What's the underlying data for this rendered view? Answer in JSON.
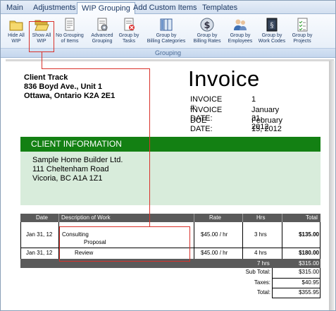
{
  "tabs": [
    {
      "label": "Main",
      "active": false
    },
    {
      "label": "Adjustments",
      "active": false
    },
    {
      "label": "WIP Grouping",
      "active": true
    },
    {
      "label": "Add Custom Items",
      "active": false
    },
    {
      "label": "Templates",
      "active": false
    }
  ],
  "ribbon": {
    "group_label": "Grouping",
    "buttons": [
      {
        "label": "Hide All\nWIP",
        "icon": "folder-icon"
      },
      {
        "label": "Show All\nWIP",
        "icon": "folder-open-icon"
      },
      {
        "label": "No Grouping\nof Items",
        "icon": "document-icon"
      },
      {
        "label": "Advanced\nGrouping",
        "icon": "document-gear-icon"
      },
      {
        "label": "Group by\nTasks",
        "icon": "document-cancel-icon"
      },
      {
        "label": "Group by\nBilling Categories",
        "icon": "columns-icon"
      },
      {
        "label": "Group by\nBilling Rates",
        "icon": "dollar-icon"
      },
      {
        "label": "Group by\nEmployees",
        "icon": "people-icon"
      },
      {
        "label": "Group by\nWork Codes",
        "icon": "book-icon"
      },
      {
        "label": "Group by\nProjects",
        "icon": "checklist-icon"
      }
    ]
  },
  "company": {
    "name": "Client Track",
    "address1": "836 Boyd Ave., Unit 1",
    "address2": "Ottawa, Ontario  K2A 2E1"
  },
  "invoice": {
    "title": "Invoice",
    "number_label": "INVOICE #:",
    "number": "1",
    "date_label": "INVOICE DATE:",
    "date": "January 31, 2012",
    "due_label": "DUE DATE:",
    "due": "February 15, 2012"
  },
  "client": {
    "heading": "CLIENT INFORMATION",
    "name": "Sample Home Builder Ltd.",
    "address1": "111 Cheltenham Road",
    "address2": "Vicoria, BC  A1A 1Z1"
  },
  "table": {
    "headers": {
      "date": "Date",
      "desc": "Description of Work",
      "rate": "Rate",
      "hrs": "Hrs",
      "total": "Total"
    },
    "rows": [
      {
        "date": "Jan 31, 12",
        "desc": "Consulting",
        "sub": "Proposal",
        "rate": "$45.00 / hr",
        "hrs": "3 hrs",
        "total": "$135.00"
      },
      {
        "date": "Jan 31, 12",
        "desc": "",
        "sub": "Review",
        "rate": "$45.00 / hr",
        "hrs": "4 hrs",
        "total": "$180.00"
      }
    ],
    "sum_hrs": "7 hrs",
    "sum_total": "$315.00"
  },
  "totals": {
    "subtotal_label": "Sub Total:",
    "subtotal": "$315.00",
    "taxes_label": "Taxes:",
    "taxes": "$40.95",
    "total_label": "Total:",
    "total": "$355.95"
  },
  "colors": {
    "client_header": "#138013",
    "client_body": "#d8ecdb",
    "annotation": "#d9312a"
  }
}
